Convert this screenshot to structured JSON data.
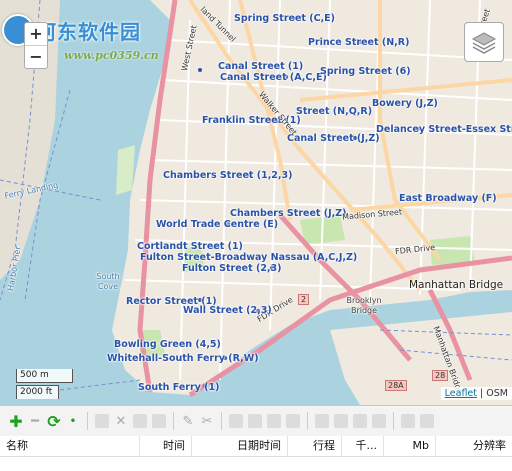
{
  "watermark": {
    "site_name": "河东软件园",
    "url": "www.pc0359.cn"
  },
  "map": {
    "labels": {
      "spring_street_ce": "Spring Street (C,E)",
      "prince_street": "Prince Street (N,R)",
      "canal_street_1": "Canal Street (1)",
      "canal_street_ace": "Canal Street (A,C,E)",
      "spring_street_6": "Spring Street (6)",
      "bowery": "Bowery (J,Z)",
      "walker_street": "Walker Street",
      "st_nqr": "Street (N,Q,R)",
      "franklin_street": "Franklin Street (1)",
      "delancey": "Delancey Street-Essex Street",
      "canal_street_jz": "Canal Street (J,Z)",
      "chambers_123": "Chambers Street (1,2,3)",
      "chambers_jz": "Chambers Street (J,Z)",
      "madison_street": "Madison Street",
      "east_broadway": "East Broadway (F)",
      "wtc": "World Trade Centre (E)",
      "cortlandt": "Cortlandt Street (1)",
      "fulton_nassau": "Fulton Street-Broadway Nassau (A,C,J,Z)",
      "fulton_23": "Fulton Street (2,3)",
      "fdr_drive": "FDR Drive",
      "fdr_drive_2": "FDR Drive",
      "manhattan_bridge": "Manhattan Bridge",
      "brooklyn_bridge": "Brooklyn Bridge",
      "rector": "Rector Street (1)",
      "wall_street": "Wall Street (2,3)",
      "bowling_green": "Bowling Green (4,5)",
      "whitehall": "Whitehall-South Ferry (R,W)",
      "south_ferry": "South Ferry (1)",
      "south_cove": "South Cove",
      "ferry_landing": "Ferry Landing",
      "pier_harbor": "Harbor Pier",
      "essex_street": "Essex Street",
      "west_street": "West Street",
      "holland_tunnel": "land Tunnel",
      "shield_2": "2",
      "shield_28": "28",
      "shield_28a": "28A",
      "manhattan_bridge_side": "Manhattan Bridge"
    },
    "zoom_in": "+",
    "zoom_out": "−",
    "scale_metric": "500 m",
    "scale_imperial": "2000 ft",
    "attribution_leaflet": "Leaflet",
    "attribution_sep": "|",
    "attribution_osm": "OSM"
  },
  "table": {
    "columns": [
      "名称",
      "时间",
      "日期时间",
      "行程",
      "千...",
      "Mb",
      "分辨率"
    ]
  },
  "colors": {
    "water": "#aad3df",
    "land": "#efe9df",
    "park": "#c8e6b0",
    "highway": "#e892a2",
    "primary": "#fcd6a4",
    "subway": "#2a52a8"
  }
}
